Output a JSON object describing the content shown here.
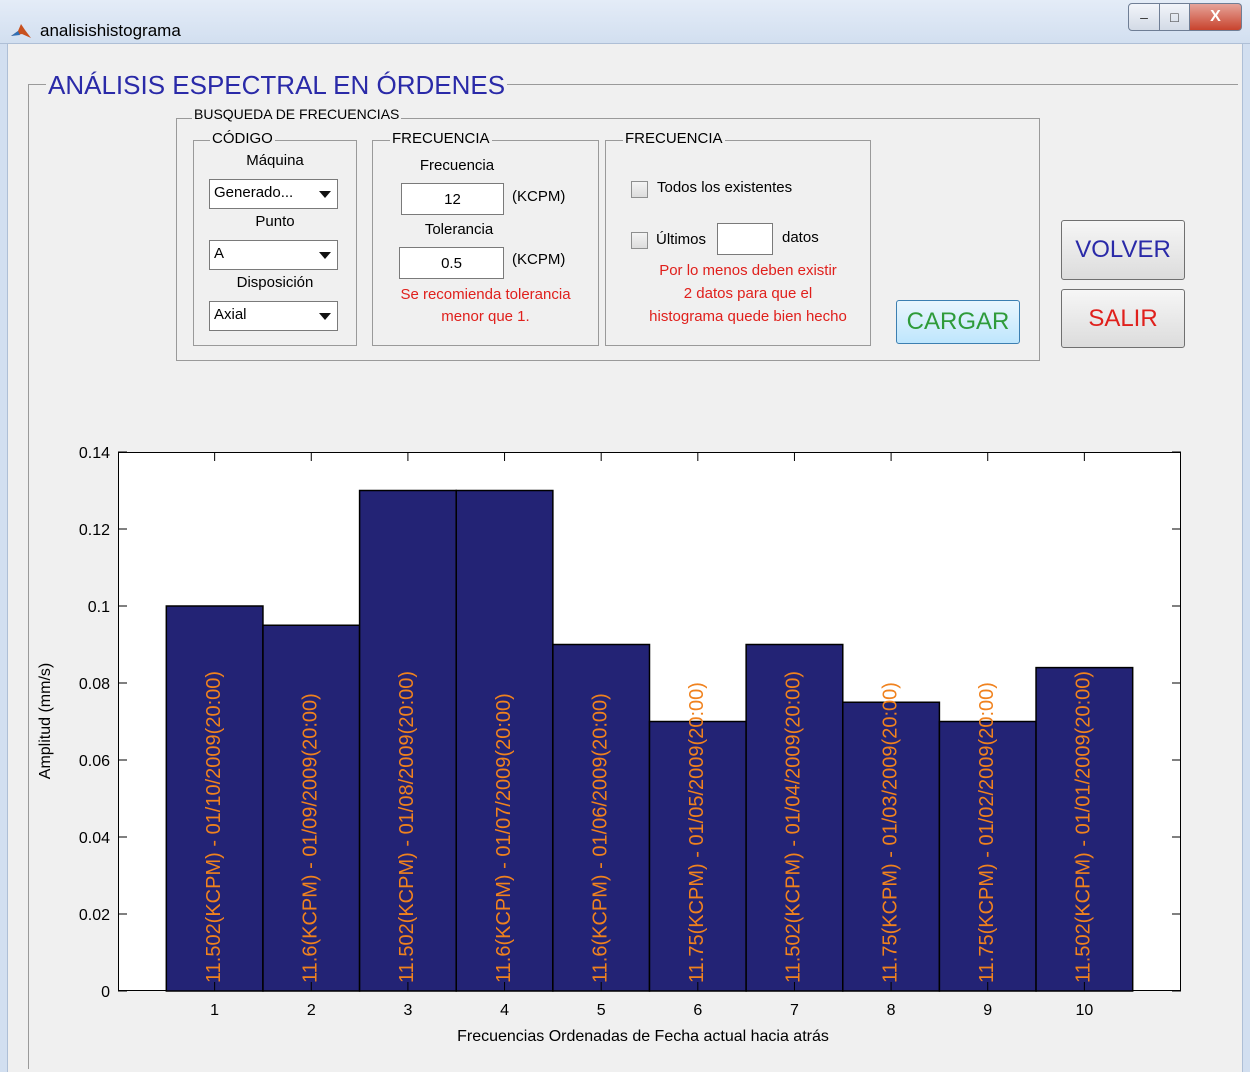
{
  "window": {
    "title": "analisishistograma",
    "minimize": "–",
    "maximize": "□",
    "close": "X"
  },
  "main_panel": {
    "title": "ANÁLISIS ESPECTRAL EN ÓRDENES"
  },
  "search_panel": {
    "title": "BUSQUEDA DE FRECUENCIAS"
  },
  "codigo": {
    "title": "CÓDIGO",
    "maquina_label": "Máquina",
    "maquina_value": "Generado...",
    "punto_label": "Punto",
    "punto_value": "A",
    "disposicion_label": "Disposición",
    "disposicion_value": "Axial"
  },
  "frecuencia": {
    "title": "FRECUENCIA",
    "frecuencia_label": "Frecuencia",
    "frecuencia_value": "12",
    "frecuencia_unit": "(KCPM)",
    "tolerancia_label": "Tolerancia",
    "tolerancia_value": "0.5",
    "tolerancia_unit": "(KCPM)",
    "warning_line1": "Se recomienda tolerancia",
    "warning_line2": "menor que 1."
  },
  "frecuencia2": {
    "title": "FRECUENCIA",
    "todos_label": "Todos los existentes",
    "ultimos_label": "Últimos",
    "ultimos_value": "",
    "datos_label": "datos",
    "note_line1": "Por lo menos deben existir",
    "note_line2": "2 datos para  que el",
    "note_line3": "histograma quede bien hecho"
  },
  "buttons": {
    "cargar": "CARGAR",
    "volver": "VOLVER",
    "salir": "SALIR"
  },
  "colors": {
    "bar": "#232375",
    "bar_label": "#f0821e",
    "title_blue": "#2a2aa8",
    "warning_red": "#e0201c",
    "cargar_text": "#2e9b3a",
    "salir_text": "#e0201c",
    "volver_text": "#2a2aa8"
  },
  "chart_data": {
    "type": "bar",
    "categories": [
      "1",
      "2",
      "3",
      "4",
      "5",
      "6",
      "7",
      "8",
      "9",
      "10"
    ],
    "values": [
      0.1,
      0.095,
      0.13,
      0.13,
      0.09,
      0.07,
      0.09,
      0.075,
      0.07,
      0.084
    ],
    "bar_labels": [
      "11.502(KCPM) - 01/10/2009(20:00)",
      "11.6(KCPM) - 01/09/2009(20:00)",
      "11.502(KCPM) - 01/08/2009(20:00)",
      "11.6(KCPM) - 01/07/2009(20:00)",
      "11.6(KCPM) - 01/06/2009(20:00)",
      "11.75(KCPM) - 01/05/2009(20:00)",
      "11.502(KCPM) - 01/04/2009(20:00)",
      "11.75(KCPM) - 01/03/2009(20:00)",
      "11.75(KCPM) - 01/02/2009(20:00)",
      "11.502(KCPM) - 01/01/2009(20:00)"
    ],
    "xlabel": "Frecuencias Ordenadas de Fecha actual hacia atrás",
    "ylabel": "Amplitud (mm/s)",
    "ylim": [
      0,
      0.14
    ],
    "xlim": [
      0,
      11
    ],
    "yticks": [
      "0",
      "0.02",
      "0.04",
      "0.06",
      "0.08",
      "0.1",
      "0.12",
      "0.14"
    ],
    "grid": false
  }
}
